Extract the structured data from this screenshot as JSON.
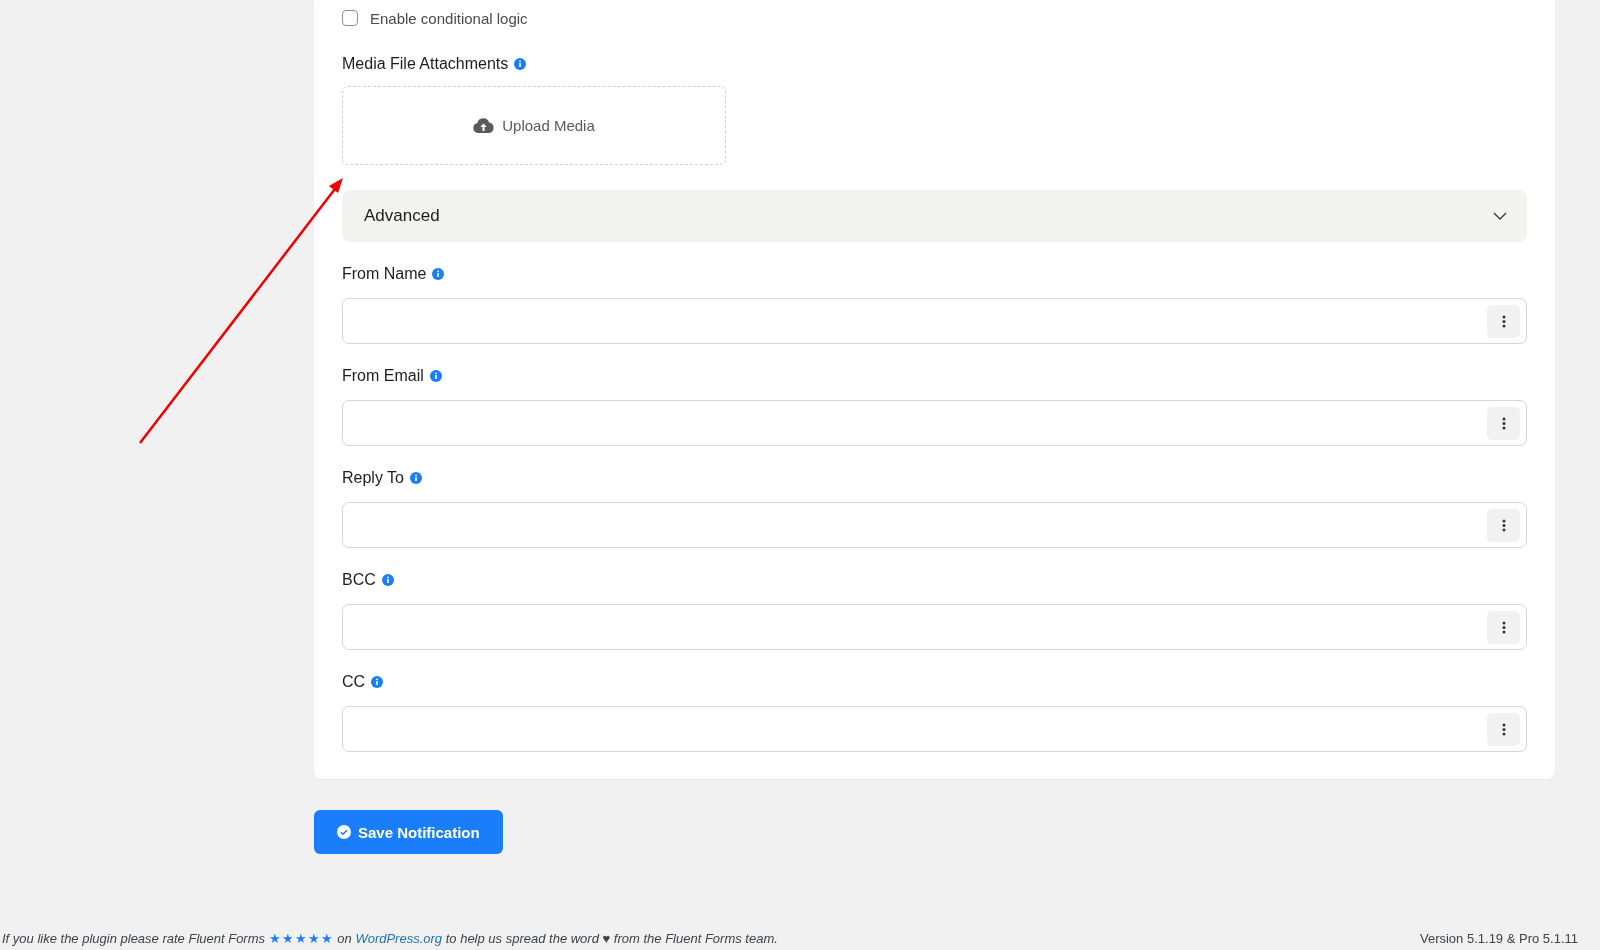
{
  "conditional_logic": {
    "label": "Enable conditional logic",
    "checked": false
  },
  "attachments": {
    "label": "Media File Attachments",
    "upload_button": "Upload Media"
  },
  "advanced_section": {
    "title": "Advanced"
  },
  "fields": [
    {
      "label": "From Name"
    },
    {
      "label": "From Email"
    },
    {
      "label": "Reply To"
    },
    {
      "label": "BCC"
    },
    {
      "label": "CC"
    }
  ],
  "save_button": "Save Notification",
  "footer": {
    "before": "If you like the plugin please rate Fluent Forms",
    "stars": "★★★★★",
    "middle": "on",
    "link": "WordPress.org",
    "after": "to help us spread the word ♥ from the Fluent Forms team.",
    "version": "Version 5.1.19 & Pro 5.1.11"
  }
}
